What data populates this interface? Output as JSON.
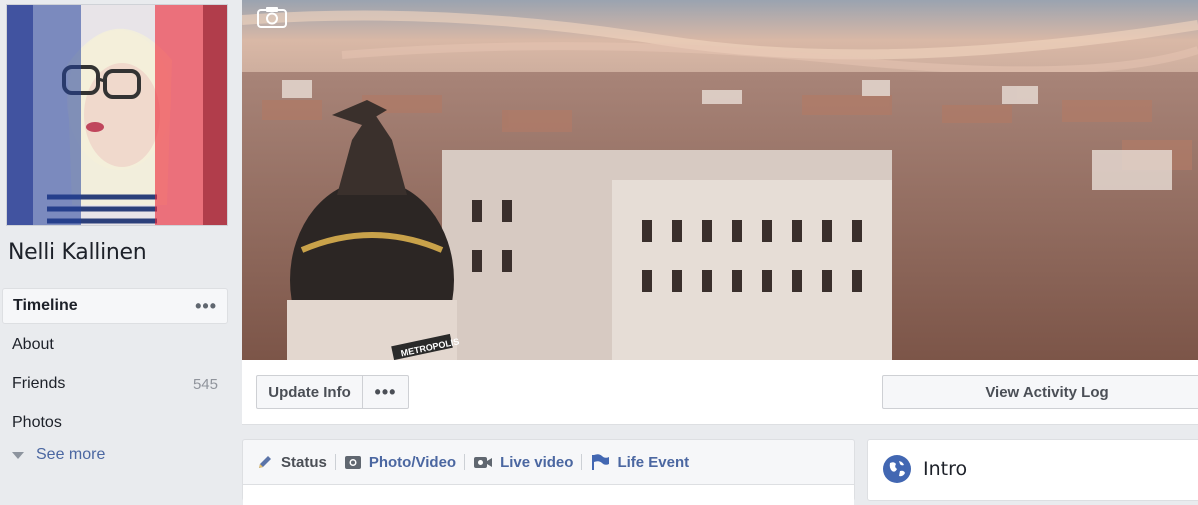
{
  "profile": {
    "name": "Nelli Kallinen",
    "picture_icon": "profile-photo-with-flag-overlay"
  },
  "nav": {
    "items": [
      {
        "label": "Timeline",
        "extra": "•••"
      },
      {
        "label": "About",
        "extra": ""
      },
      {
        "label": "Friends",
        "extra": "545"
      },
      {
        "label": "Photos",
        "extra": ""
      }
    ],
    "see_more": "See more"
  },
  "cover": {
    "camera_icon": "camera-icon",
    "sign_text": "METROPOLIS"
  },
  "actions": {
    "update_info": "Update Info",
    "more": "•••",
    "view_activity_log": "View Activity Log"
  },
  "composer": {
    "tabs": [
      {
        "label": "Status",
        "icon": "pencil-icon"
      },
      {
        "label": "Photo/Video",
        "icon": "photo-icon"
      },
      {
        "label": "Live video",
        "icon": "video-camera-icon"
      },
      {
        "label": "Life Event",
        "icon": "flag-icon"
      }
    ]
  },
  "intro": {
    "title": "Intro",
    "icon": "globe-icon"
  },
  "colors": {
    "link": "#4b67a1",
    "background": "#e9ebee",
    "flag_blue": "#21409a",
    "flag_red": "#ed2939"
  }
}
